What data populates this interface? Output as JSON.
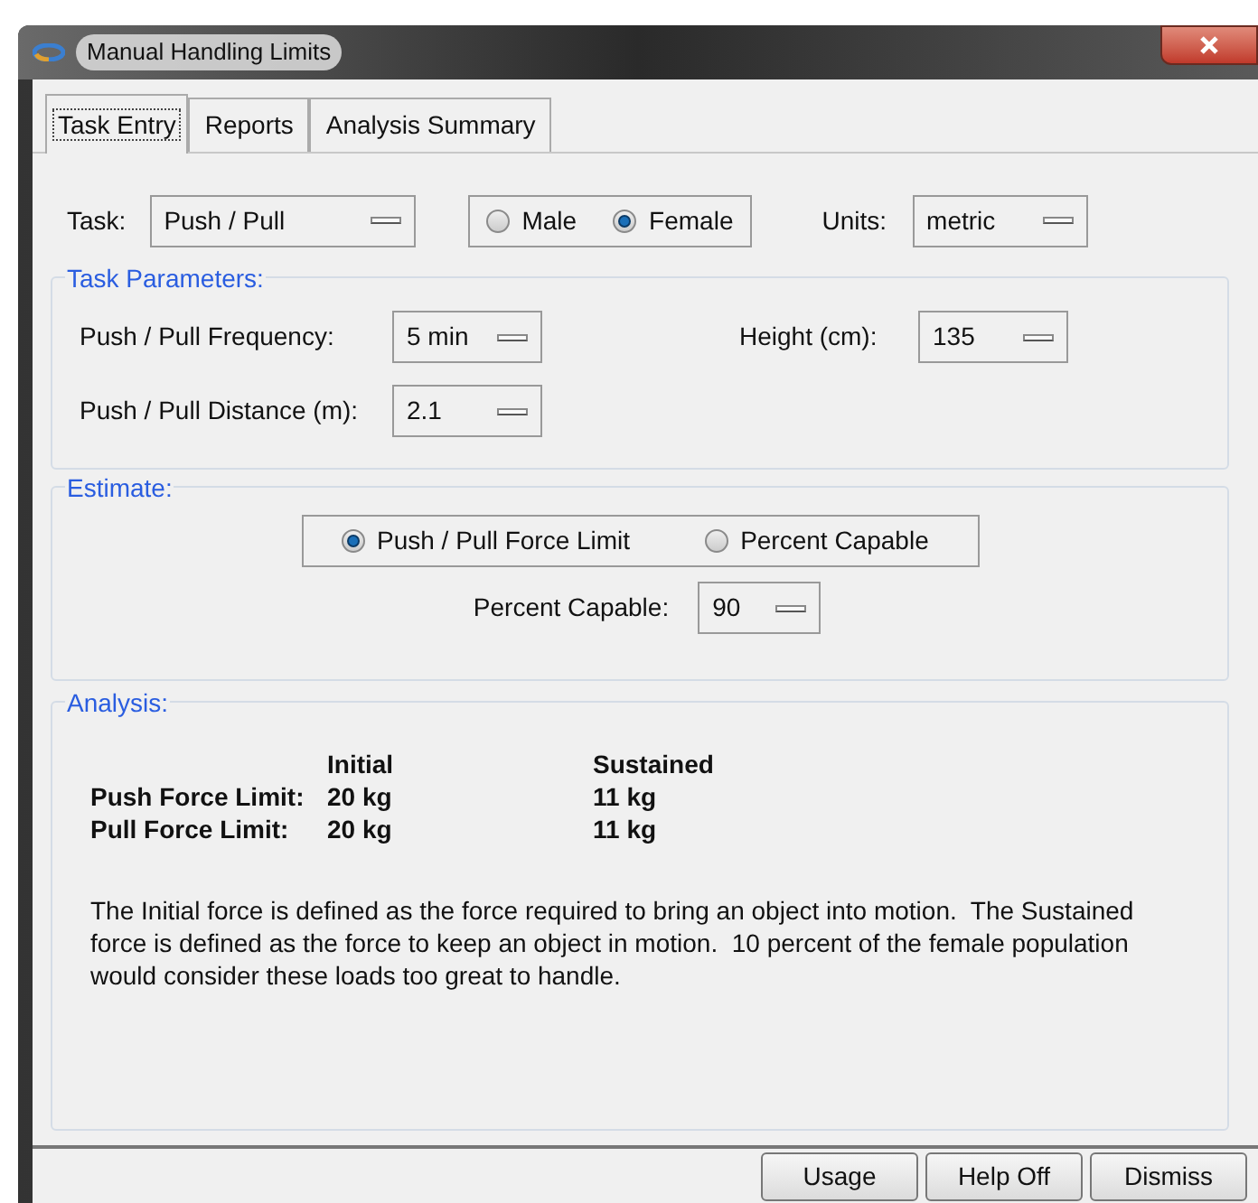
{
  "window": {
    "title": "Manual Handling Limits"
  },
  "tabs": [
    {
      "label": "Task Entry",
      "selected": true
    },
    {
      "label": "Reports",
      "selected": false
    },
    {
      "label": "Analysis Summary",
      "selected": false
    }
  ],
  "task_row": {
    "task": {
      "label": "Task:",
      "value": "Push / Pull"
    },
    "sex_options": [
      {
        "label": "Male",
        "selected": false
      },
      {
        "label": "Female",
        "selected": true
      }
    ],
    "units": {
      "label": "Units:",
      "value": "metric"
    }
  },
  "task_parameters": {
    "title": "Task Parameters:",
    "fields": [
      {
        "label": "Push / Pull Frequency:",
        "value": "5 min"
      },
      {
        "label": "Height (cm):",
        "value": "135"
      },
      {
        "label": "Push / Pull Distance (m):",
        "value": "2.1"
      }
    ]
  },
  "estimate": {
    "title": "Estimate:",
    "options": [
      {
        "label": "Push / Pull Force Limit",
        "selected": true
      },
      {
        "label": "Percent Capable",
        "selected": false
      }
    ],
    "percent_capable": {
      "label": "Percent Capable:",
      "value": "90"
    }
  },
  "analysis": {
    "title": "Analysis:",
    "columns": [
      "Initial",
      "Sustained"
    ],
    "rows": [
      {
        "label": "Push Force Limit:",
        "initial": "20 kg",
        "sustained": "11 kg"
      },
      {
        "label": "Pull Force Limit:",
        "initial": "20 kg",
        "sustained": "11 kg"
      }
    ],
    "note": "The Initial force is defined as the force required to bring an object into motion.  The Sustained force is defined as the force to keep an object in motion.  10 percent of the female population would consider these loads too great to handle."
  },
  "buttons": [
    "Usage",
    "Help Off",
    "Dismiss"
  ]
}
